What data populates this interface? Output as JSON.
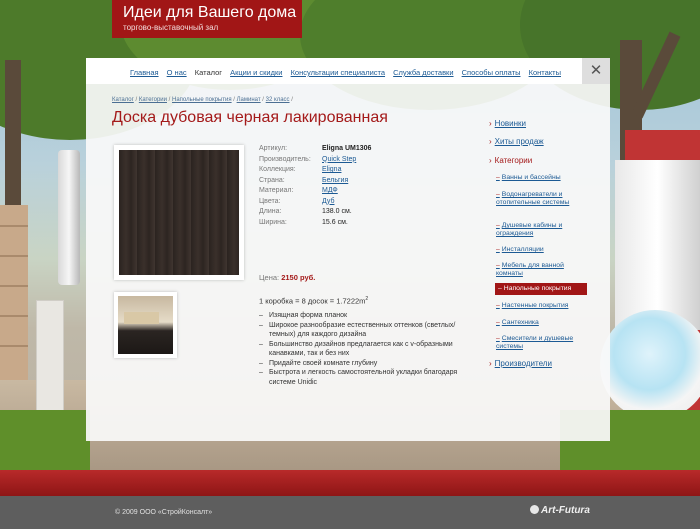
{
  "brand": {
    "title": "Идеи для Вашего дома",
    "subtitle": "торгово-выставочный зал"
  },
  "nav": {
    "items": [
      "Главная",
      "О нас",
      "Каталог",
      "Акции и скидки",
      "Консультации специалиста",
      "Служба доставки",
      "Способы оплаты",
      "Контакты"
    ],
    "current": "Каталог",
    "close_icon": "✕"
  },
  "breadcrumb": [
    "Каталог",
    "Категории",
    "Напольные покрытия",
    "Ламинат",
    "32 класс"
  ],
  "product": {
    "title": "Доска дубовая черная лакированная",
    "specs": [
      {
        "key": "Артикул:",
        "value": "Eligna UM1306"
      },
      {
        "key": "Производитель:",
        "value": "Quick Step"
      },
      {
        "key": "Коллекция:",
        "value": "Eligna"
      },
      {
        "key": "Страна:",
        "value": "Бельгия"
      },
      {
        "key": "Материал:",
        "value": "МДФ"
      },
      {
        "key": "Цвета:",
        "value": "Дуб"
      },
      {
        "key": "Длина:",
        "value": "138.0 см."
      },
      {
        "key": "Ширина:",
        "value": "15.6 см."
      }
    ],
    "price_label": "Цена:",
    "price": "2150 руб.",
    "pack": "1 коробка = 8 досок = 1.7222m",
    "pack_sup": "2",
    "features": [
      "Изящная форма планок",
      "Широкое разнообразие естественных оттенков (светлых/темных) для каждого дизайна",
      "Большинство дизайнов предлагается как с v-образными канавками, так и без них",
      "Придайте своей комнате глубину",
      "Быстрота и легкость самостоятельной укладки благодаря системе Unidic"
    ]
  },
  "sidebar": {
    "chevron": "›",
    "dash": "–",
    "news": "Новинки",
    "hits": "Хиты продаж",
    "categories": "Категории",
    "subcategories": [
      "Ванны и бассейны",
      "Водонагреватели и отопительные системы",
      "Душевые кабины и ограждения",
      "Инсталляции",
      "Мебель для ванной комнаты",
      "Напольные покрытия",
      "Настенные покрытия",
      "Сантехника",
      "Смесители и душевые системы"
    ],
    "active_subcategory": "Напольные покрытия",
    "manufacturers": "Производители"
  },
  "footer": {
    "copyright": "© 2009 ООО «СтройКонсалт»",
    "brand": "Art-Futura"
  }
}
